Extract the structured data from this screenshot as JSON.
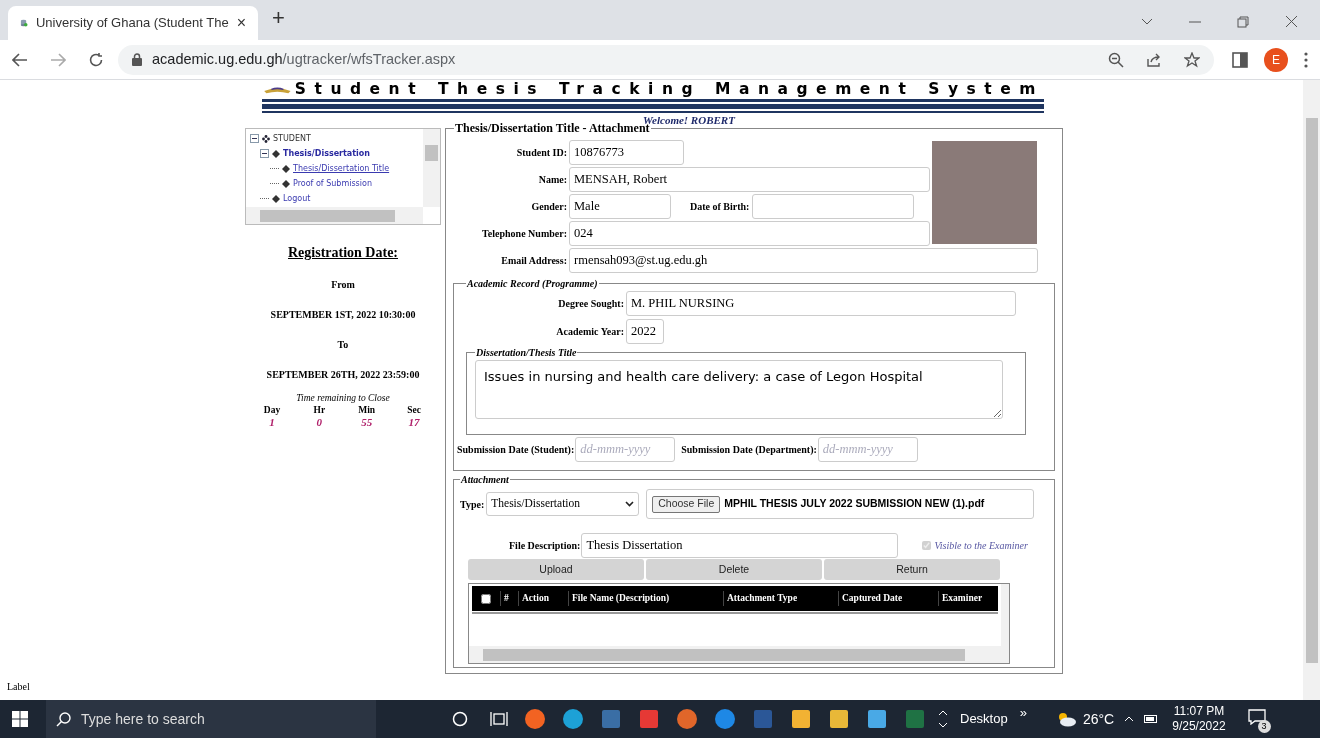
{
  "browser": {
    "tab_title": "University of Ghana (Student The",
    "tab_close": "×",
    "new_tab": "+",
    "url_host": "academic.ug.edu.gh",
    "url_path": "/ugtracker/wfsTracker.aspx",
    "profile_initial": "E"
  },
  "header": {
    "title": "Student Thesis Tracking Management System",
    "welcome": "Welcome! ROBERT"
  },
  "tree": [
    {
      "label": "STUDENT",
      "expanded": true,
      "selected": false,
      "children": [
        {
          "label": "Thesis/Dissertation",
          "expanded": true,
          "selected": false,
          "children": [
            {
              "label": "Thesis/Dissertation Title",
              "selected": true
            },
            {
              "label": "Proof of Submission",
              "selected": false
            }
          ]
        },
        {
          "label": "Logout",
          "selected": false
        }
      ]
    }
  ],
  "registration": {
    "heading": "Registration Date:",
    "from_label": "From",
    "from": "SEPTEMBER 1ST, 2022 10:30:00",
    "to_label": "To",
    "to": "SEPTEMBER 26TH, 2022 23:59:00",
    "countdown_title": "Time remaining to Close",
    "countdown": [
      {
        "label": "Day",
        "value": "1"
      },
      {
        "label": "Hr",
        "value": "0"
      },
      {
        "label": "Min",
        "value": "55"
      },
      {
        "label": "Sec",
        "value": "17"
      }
    ]
  },
  "form": {
    "legend": "Thesis/Dissertation Title - Attachment",
    "student_id": {
      "label": "Student ID:",
      "value": "10876773"
    },
    "name": {
      "label": "Name:",
      "value": "MENSAH, Robert"
    },
    "gender": {
      "label": "Gender:",
      "value": "Male"
    },
    "date_of_birth": {
      "label": "Date of Birth:"
    },
    "telephone": {
      "label": "Telephone Number:",
      "value": "024"
    },
    "email": {
      "label": "Email Address:",
      "value": "rmensah093@st.ug.edu.gh"
    },
    "academic": {
      "legend": "Academic Record (Programme)",
      "degree": {
        "label": "Degree Sought:",
        "value": "M. PHIL NURSING"
      },
      "year": {
        "label": "Academic Year:",
        "value": "2022"
      },
      "title_legend": "Dissertation/Thesis Title",
      "title": "Issues in nursing and health care delivery: a case of Legon Hospital",
      "submission_student": {
        "label": "Submission Date (Student):",
        "placeholder": "dd-mmm-yyyy"
      },
      "submission_department": {
        "label": "Submission Date (Department):",
        "placeholder": "dd-mmm-yyyy"
      }
    },
    "attachment": {
      "legend": "Attachment",
      "type": {
        "label": "Type:",
        "value": "Thesis/Dissertation"
      },
      "file": {
        "button": "Choose File",
        "name": "MPHIL THESIS JULY 2022 SUBMISSION NEW (1).pdf"
      },
      "description": {
        "label": "File Description:",
        "value": "Thesis Dissertation"
      },
      "visible": {
        "label": "Visible to the Examiner",
        "checked": true,
        "disabled": true
      },
      "buttons": [
        "Upload",
        "Delete",
        "Return"
      ],
      "table": {
        "select_all_checked": false,
        "columns": [
          "#",
          "Action",
          "File Name (Description)",
          "Attachment Type",
          "Captured Date",
          "Examiner"
        ]
      }
    }
  },
  "status_label": "Label",
  "taskbar": {
    "search_placeholder": "Type here to search",
    "desktop": "Desktop",
    "chevron": "»",
    "temperature": "26°C",
    "time": "11:07 PM",
    "date": "9/25/2022",
    "notifications": "3"
  }
}
